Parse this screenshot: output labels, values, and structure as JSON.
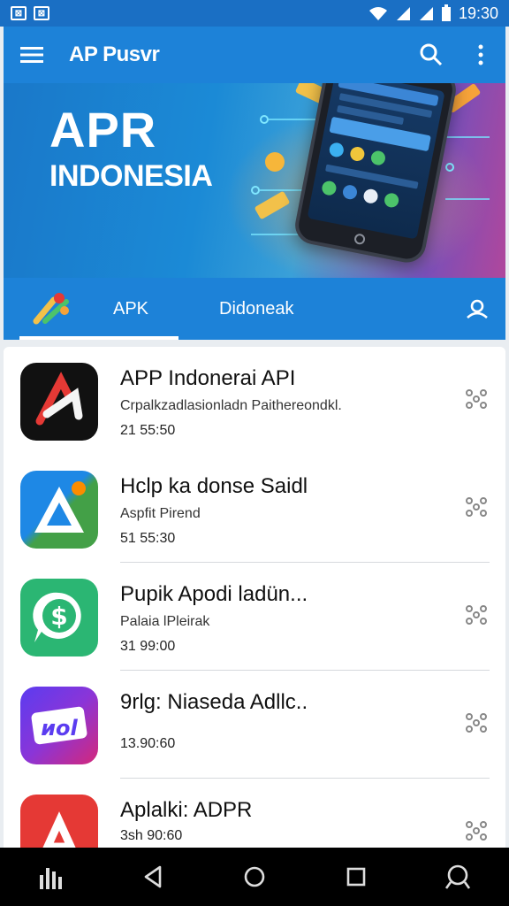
{
  "status_bar": {
    "time": "19:30"
  },
  "app_bar": {
    "title": "AP Pusvr"
  },
  "banner": {
    "title_line1": "APR",
    "title_line2": "INDONESIA"
  },
  "tabs": [
    {
      "label": "APK",
      "selected": true
    },
    {
      "label": "Didoneak",
      "selected": false
    }
  ],
  "apps": [
    {
      "title": "APP Indonerai API",
      "subtitle": "Crpalkzadlasionladn Paithereondkl.",
      "meta": "21 55:50",
      "icon": "red-a-logo",
      "colors": [
        "#111111",
        "#e53935"
      ]
    },
    {
      "title": "Hclp ka donse Saidl",
      "subtitle": "Aspfit Pirend",
      "meta": "51 55:30",
      "icon": "triangle-logo",
      "colors": [
        "#1e88e5",
        "#43a047",
        "#fb8c00"
      ]
    },
    {
      "title": "Pupik Apodi ladün...",
      "subtitle": "Palaia lPleirak",
      "meta": "31 99:00",
      "icon": "dollar-chat-logo",
      "colors": [
        "#2bb673",
        "#ffffff"
      ]
    },
    {
      "title": "9rlg: Niaseda Adllc..",
      "subtitle": "",
      "meta": "13.90:60",
      "icon": "nol-logo",
      "colors": [
        "#5b3cf0",
        "#d4287a"
      ]
    },
    {
      "title": "Aplalki: ADPR",
      "subtitle": "",
      "meta": "3sh 90:60",
      "icon": "red-a-logo",
      "colors": [
        "#e53935",
        "#ffffff"
      ]
    }
  ]
}
